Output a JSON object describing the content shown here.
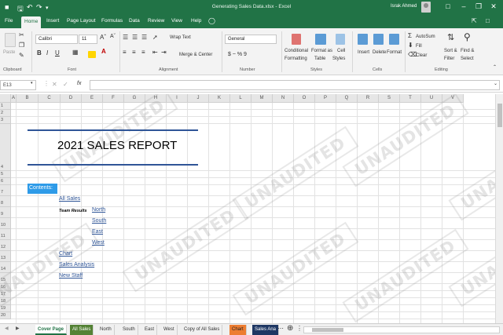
{
  "window": {
    "title": "Generating Sales Data.xlsx  -  Excel",
    "user": "Israk Ahmed",
    "controls": [
      "minimize-icon",
      "restore-icon",
      "close-icon"
    ]
  },
  "ribbon_tabs": [
    "File",
    "Home",
    "Insert",
    "Page Layout",
    "Formulas",
    "Data",
    "Review",
    "View",
    "Help"
  ],
  "active_tab": "Home",
  "ribbon": {
    "clipboard": {
      "paste": "Paste",
      "label": "Clipboard"
    },
    "font": {
      "name": "Calibri",
      "size": "11",
      "label": "Font"
    },
    "alignment": {
      "wrap": "Wrap Text",
      "merge": "Merge & Center",
      "label": "Alignment"
    },
    "number": {
      "format": "General",
      "label": "Number",
      "symbols": "$  ~  %  9"
    },
    "styles": {
      "conditional": "Conditional",
      "conditional2": "Formatting",
      "format_as": "Format as",
      "format_as2": "Table",
      "cell": "Cell",
      "cell2": "Styles",
      "label": "Styles"
    },
    "cells": {
      "insert": "Insert",
      "delete": "Delete",
      "format": "Format",
      "label": "Cells"
    },
    "editing": {
      "autosum": "AutoSum",
      "fill": "Fill",
      "clear": "Clear",
      "sort": "Sort &",
      "sort2": "Filter",
      "find": "Find &",
      "find2": "Select",
      "label": "Editing"
    }
  },
  "formula_bar": {
    "name_box": "E13",
    "fx": "fx",
    "content": ""
  },
  "columns": [
    "A",
    "B",
    "C",
    "D",
    "E",
    "F",
    "G",
    "H",
    "I",
    "J",
    "K",
    "L",
    "M",
    "N",
    "O",
    "P",
    "Q",
    "R",
    "S",
    "T",
    "U",
    "V"
  ],
  "rows": [
    "1",
    "2",
    "3",
    "4",
    "5",
    "6",
    "7",
    "8",
    "9",
    "10",
    "11",
    "12",
    "13",
    "14",
    "15",
    "16",
    "17",
    "18",
    "19",
    "20"
  ],
  "report_title": "2021 SALES REPORT",
  "contents_label": "Contents:",
  "links": {
    "all_sales": "All Sales",
    "north": "North",
    "south": "South",
    "east": "East",
    "west": "West",
    "chart": "Chart",
    "sales_analysis": "Sales Analysis",
    "new_staff": "New Staff"
  },
  "team_results_label": "Team Results",
  "watermark_text": "UNAUDITED",
  "sheet_tabs": [
    {
      "label": "Cover Page",
      "color": "#ffffff"
    },
    {
      "label": "All Sales",
      "color": "#548235"
    },
    {
      "label": "North",
      "color": ""
    },
    {
      "label": "South",
      "color": ""
    },
    {
      "label": "East",
      "color": ""
    },
    {
      "label": "West",
      "color": ""
    },
    {
      "label": "Copy of All Sales",
      "color": ""
    },
    {
      "label": "Chart",
      "color": "#ed7d31"
    },
    {
      "label": "Sales Ana",
      "color": "#1f3864"
    }
  ],
  "colors": {
    "excel_green": "#217346",
    "title_rule": "#2f5597",
    "contents_fill": "#2e9be8",
    "link": "#2f5597"
  }
}
